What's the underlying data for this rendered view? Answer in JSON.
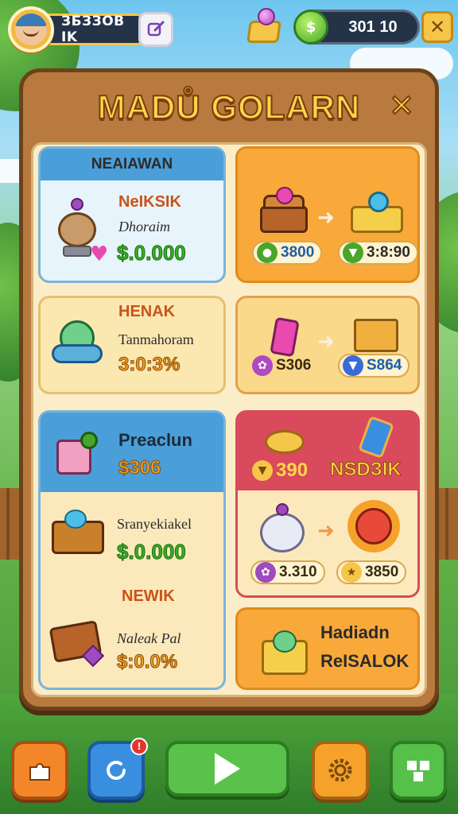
{
  "hud": {
    "player_name": "ЗБЗЗОВ IK",
    "coins": "301 10",
    "close_label": "✕"
  },
  "panel": {
    "title": "MADŮ GOLARN",
    "close_label": "✕"
  },
  "cards": {
    "card1": {
      "header": "NEAIAWAN",
      "title": "NeIKSIK",
      "subtitle": "Dhoraim",
      "price": "$.0.000"
    },
    "card2": {
      "cost_from": "3800",
      "cost_to": "3:8:90"
    },
    "card3": {
      "title": "HENAK",
      "subtitle": "Tanmahoram",
      "price": "3:0:3%"
    },
    "card4": {
      "cost_from": "S306",
      "cost_to": "S864"
    },
    "card5": {
      "title": "Preaclun",
      "price": "$306",
      "row2_title": "Sranyekiakel",
      "row2_price": "$.0.000",
      "row3_header": "NEWIK",
      "row3_title": "Naleak Pal",
      "row3_price": "$:0.0%"
    },
    "card6": {
      "cost": "390",
      "label": "NSDЗIK",
      "cost_from": "3.310",
      "cost_to": "3850",
      "bundle_title": "Hadiadn",
      "bundle_sub": "ReISALOK"
    }
  },
  "colors": {
    "panel_wood": "#b87a3e",
    "panel_border": "#6d4219",
    "panel_inner": "#fbedc8",
    "card_orange": "#f9a93a",
    "card_blue": "#4a9fd8",
    "card_pink": "#d94a5c",
    "price_green": "#37b024",
    "price_orange": "#f0a020",
    "title_gold": "#ffd54a"
  },
  "bottom_bar": {
    "buttons": [
      {
        "icon": "puzzle-icon"
      },
      {
        "icon": "refresh-icon",
        "badge": "!"
      },
      {
        "icon": "play-icon"
      },
      {
        "icon": "gear-icon"
      },
      {
        "icon": "building-icon"
      }
    ]
  }
}
